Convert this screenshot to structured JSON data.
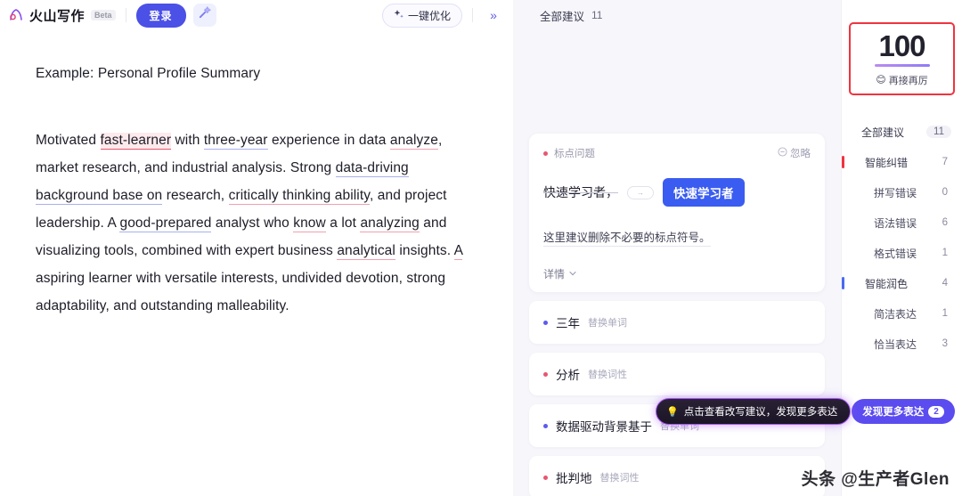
{
  "header": {
    "brand_name": "火山写作",
    "beta_tag": "Beta",
    "login_label": "登录",
    "magic_icon": "magic-wand-icon",
    "optimize_label": "一键优化",
    "optimize_icon": "sparkle-icon",
    "collapse_icon": "»"
  },
  "document": {
    "title": "Example: Personal Profile Summary",
    "paragraph": [
      {
        "t": "Motivated ",
        "s": "plain"
      },
      {
        "t": "fast-learner",
        "s": "err-red"
      },
      {
        "t": " with ",
        "s": "plain"
      },
      {
        "t": "three-year",
        "s": "und-blue"
      },
      {
        "t": " experience in data ",
        "s": "plain"
      },
      {
        "t": "analyze",
        "s": "und-red"
      },
      {
        "t": ", market research, and industrial analysis. Strong ",
        "s": "plain"
      },
      {
        "t": "data-driving background base on",
        "s": "und-blue"
      },
      {
        "t": " research, ",
        "s": "plain"
      },
      {
        "t": "critically thinking ability",
        "s": "und-red"
      },
      {
        "t": ", and project leadership. A ",
        "s": "plain"
      },
      {
        "t": "good-prepared",
        "s": "und-blue"
      },
      {
        "t": " analyst who ",
        "s": "plain"
      },
      {
        "t": "know",
        "s": "und-red"
      },
      {
        "t": " a lot ",
        "s": "plain"
      },
      {
        "t": "analyzing",
        "s": "und-red"
      },
      {
        "t": " and visualizing tools, combined with expert business ",
        "s": "plain"
      },
      {
        "t": "analytical",
        "s": "und-red"
      },
      {
        "t": " insights. ",
        "s": "plain"
      },
      {
        "t": "A",
        "s": "und-red"
      },
      {
        "t": " aspiring learner with versatile interests, undivided devotion, strong adaptability, and outstanding malleability.",
        "s": "plain"
      }
    ]
  },
  "suggestions_panel": {
    "header_label": "全部建议",
    "header_count": "11",
    "card": {
      "tag": "标点问题",
      "ignore_label": "忽略",
      "ignore_icon": "minus-circle-icon",
      "original": "快速学习者，",
      "arrow_icon": "→",
      "replacement": "快速学习者",
      "description": "这里建议删除不必要的标点符号。",
      "more_label": "详情",
      "more_icon": "chevron-down-icon"
    },
    "items": [
      {
        "word": "三年",
        "kind": "替换单词",
        "color": "blue"
      },
      {
        "word": "分析",
        "kind": "替换词性",
        "color": "red"
      },
      {
        "word": "数据驱动背景基于",
        "kind": "替换单词",
        "color": "blue"
      },
      {
        "word": "批判地",
        "kind": "替换词性",
        "color": "red"
      }
    ],
    "tooltip": {
      "icon": "lightbulb-icon",
      "text": "点击查看改写建议，发现更多表达"
    }
  },
  "sidebar": {
    "score": "100",
    "score_label": "再接再厉",
    "score_emoji": "😊",
    "rows": [
      {
        "label": "全部建议",
        "value": "11",
        "level": "all",
        "mark": ""
      },
      {
        "label": "智能纠错",
        "value": "7",
        "level": "main",
        "mark": "#f0333f"
      },
      {
        "label": "拼写错误",
        "value": "0",
        "level": "sub",
        "mark": ""
      },
      {
        "label": "语法错误",
        "value": "6",
        "level": "sub",
        "mark": ""
      },
      {
        "label": "格式错误",
        "value": "1",
        "level": "sub",
        "mark": ""
      },
      {
        "label": "智能润色",
        "value": "4",
        "level": "main",
        "mark": "#4a6af0"
      },
      {
        "label": "简洁表达",
        "value": "1",
        "level": "sub",
        "mark": ""
      },
      {
        "label": "恰当表达",
        "value": "3",
        "level": "sub",
        "mark": ""
      }
    ],
    "discover_label": "发现更多表达",
    "discover_badge": "2"
  },
  "watermark": "头条 @生产者Glen",
  "colors": {
    "accent_purple": "#5b4cf0",
    "error_red": "#e8566f",
    "score_border": "#f0333f",
    "panel_bg": "#f6f6fb"
  }
}
